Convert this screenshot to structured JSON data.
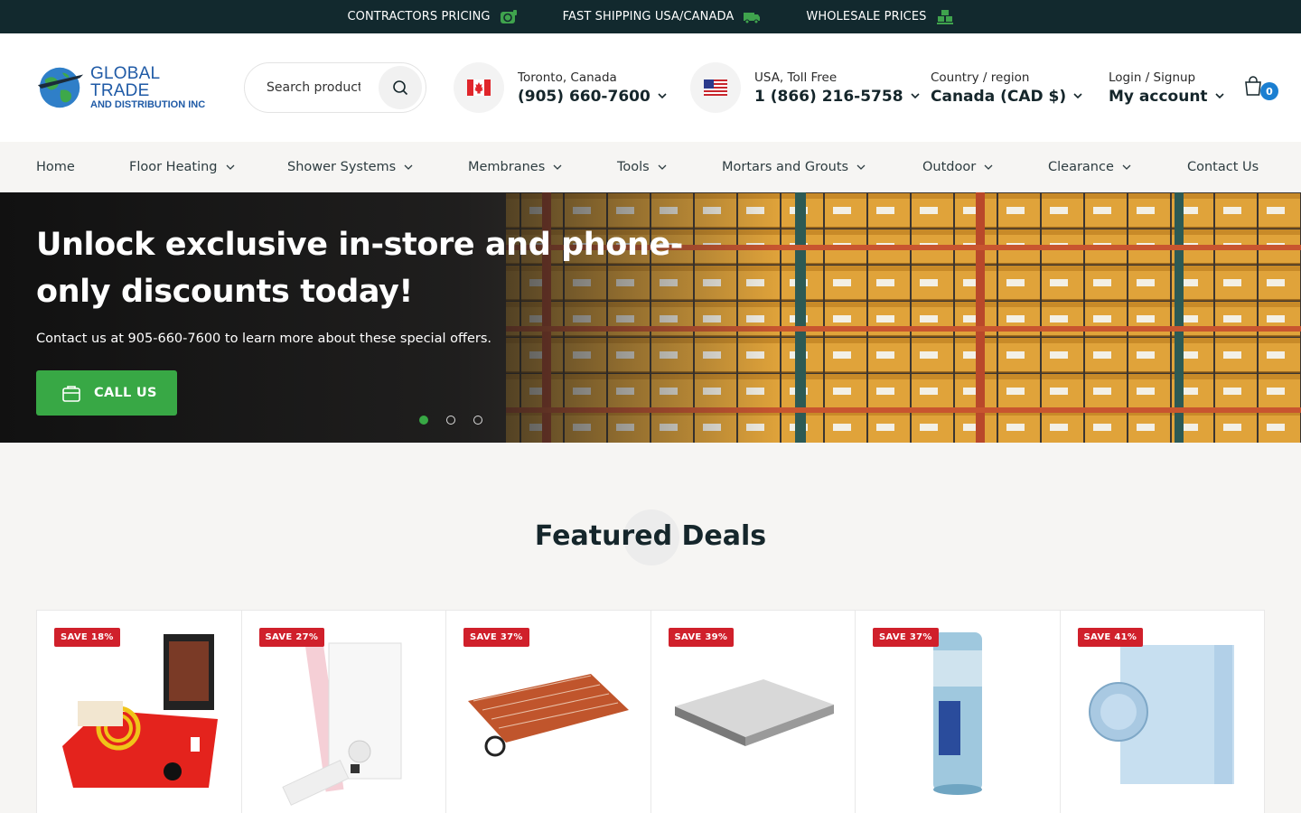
{
  "topbar": {
    "items": [
      {
        "label": "CONTRACTORS PRICING",
        "icon": "money-icon"
      },
      {
        "label": "FAST SHIPPING USA/CANADA",
        "icon": "truck-icon"
      },
      {
        "label": "WHOLESALE PRICES",
        "icon": "boxes-icon"
      }
    ]
  },
  "brand": {
    "line1": "GLOBAL TRADE",
    "line2": "AND DISTRIBUTION INC"
  },
  "search": {
    "placeholder": "Search products"
  },
  "contacts": [
    {
      "label": "Toronto, Canada",
      "value": "(905) 660-7600",
      "flag": "canada-flag-icon"
    },
    {
      "label": "USA, Toll Free",
      "value": "1 (866) 216-5758",
      "flag": "usa-flag-icon"
    }
  ],
  "region": {
    "label": "Country / region",
    "value": "Canada (CAD $)"
  },
  "account": {
    "label": "Login / Signup",
    "value": "My account"
  },
  "cart": {
    "count": "0"
  },
  "nav": {
    "items": [
      {
        "label": "Home"
      },
      {
        "label": "Floor Heating"
      },
      {
        "label": "Shower Systems"
      },
      {
        "label": "Membranes"
      },
      {
        "label": "Tools"
      },
      {
        "label": "Mortars and Grouts"
      },
      {
        "label": "Outdoor"
      },
      {
        "label": "Clearance"
      },
      {
        "label": "Contact Us"
      }
    ]
  },
  "hero": {
    "title": "Unlock exclusive in-store and phone-only discounts today!",
    "subtitle": "Contact us at 905-660-7600 to learn more about these special offers.",
    "cta": "CALL US",
    "slides": 3,
    "active_slide": 1
  },
  "featured": {
    "title": "Featured Deals",
    "products": [
      {
        "badge": "SAVE 18%"
      },
      {
        "badge": "SAVE 27%"
      },
      {
        "badge": "SAVE 37%"
      },
      {
        "badge": "SAVE 39%"
      },
      {
        "badge": "SAVE 37%"
      },
      {
        "badge": "SAVE 41%"
      }
    ]
  },
  "colors": {
    "topbar": "#12292e",
    "accent_green": "#38a845",
    "sale_red": "#d0202b",
    "cart_badge": "#1b7fd1",
    "brand_blue": "#1f5aa6"
  }
}
